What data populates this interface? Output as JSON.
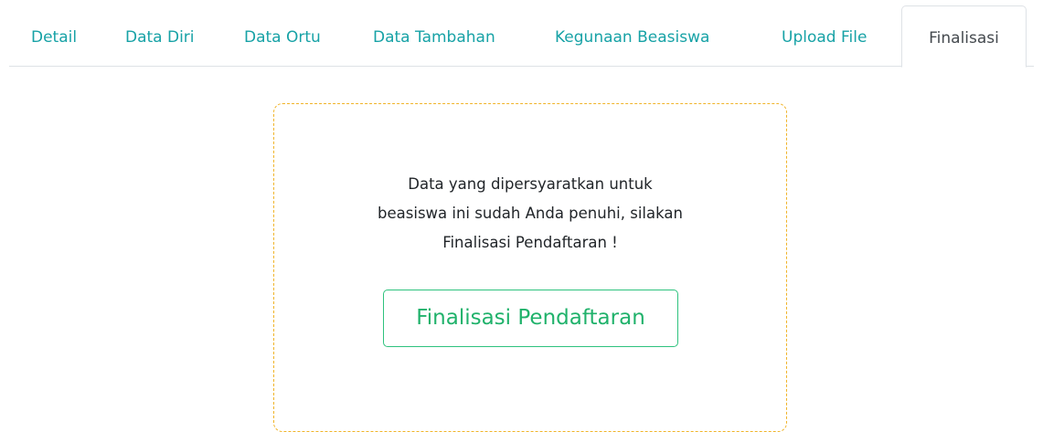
{
  "tabs": [
    {
      "label": "Detail"
    },
    {
      "label": "Data Diri"
    },
    {
      "label": "Data Ortu"
    },
    {
      "label": "Data Tambahan"
    },
    {
      "label": "Kegunaan Beasiswa"
    },
    {
      "label": "Upload File"
    },
    {
      "label": "Finalisasi"
    }
  ],
  "active_tab": "Finalisasi",
  "finalization": {
    "message_lines": [
      "Data yang dipersyaratkan untuk",
      "beasiswa ini sudah Anda penuhi, silakan",
      "Finalisasi Pendaftaran !"
    ],
    "button_label": "Finalisasi Pendaftaran"
  },
  "colors": {
    "tab_link": "#17a2a6",
    "tab_active_text": "#454a4f",
    "card_border": "#f0b429",
    "button_green": "#20b26b"
  }
}
